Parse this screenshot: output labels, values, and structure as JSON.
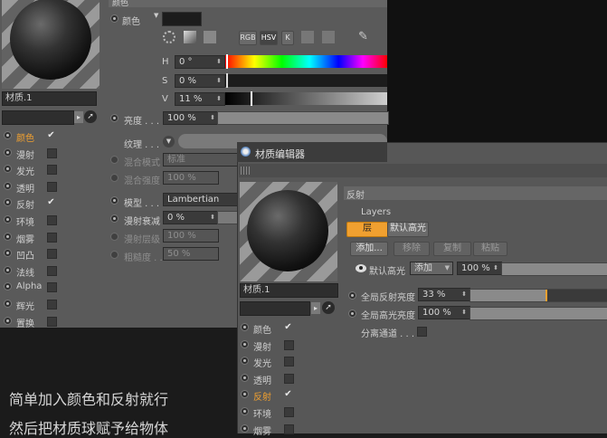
{
  "back_panel": {
    "section_title": "颜色",
    "color_label": "颜色",
    "mode_tabs": [
      "RGB",
      "HSV",
      "K"
    ],
    "h_label": "H",
    "h_value": "0 °",
    "s_label": "S",
    "s_value": "0 %",
    "v_label": "V",
    "v_value": "11 %",
    "brightness_label": "亮度 . . .",
    "brightness_value": "100 %",
    "texture_label": "纹理 . . .",
    "mix_mode_label": "混合模式",
    "mix_mode_value": "标准",
    "mix_strength_label": "混合强度",
    "mix_strength_value": "100 %",
    "model_label": "模型 . . .",
    "model_value": "Lambertian",
    "diffuse_falloff_label": "漫射衰减",
    "diffuse_falloff_value": "0 %",
    "diffuse_level_label": "漫射层级",
    "diffuse_level_value": "100 %",
    "roughness_label": "粗糙度 . .",
    "roughness_value": "50 %"
  },
  "left_material": {
    "name": "材质.1",
    "channels": [
      {
        "label": "颜色",
        "checked": true,
        "active": true
      },
      {
        "label": "漫射",
        "checked": false,
        "active": false
      },
      {
        "label": "发光",
        "checked": false,
        "active": false
      },
      {
        "label": "透明",
        "checked": false,
        "active": false
      },
      {
        "label": "反射",
        "checked": true,
        "active": false
      },
      {
        "label": "环境",
        "checked": false,
        "active": false
      },
      {
        "label": "烟雾",
        "checked": false,
        "active": false
      },
      {
        "label": "凹凸",
        "checked": false,
        "active": false
      },
      {
        "label": "法线",
        "checked": false,
        "active": false
      },
      {
        "label": "Alpha",
        "checked": false,
        "active": false
      },
      {
        "label": "辉光",
        "checked": false,
        "active": false
      },
      {
        "label": "置换",
        "checked": false,
        "active": false
      }
    ]
  },
  "editor": {
    "title": "材质编辑器",
    "name": "材质.1",
    "section_title": "反射",
    "layers_label": "Layers",
    "layer_tab": "层",
    "default_highlight_tab": "默认高光",
    "add_button": "添加...",
    "remove_button": "移除",
    "copy_button": "复制",
    "paste_button": "粘贴",
    "highlight_row_label": "默认高光",
    "blend_value": "添加",
    "highlight_value": "100 %",
    "global_reflect_label": "全局反射亮度",
    "global_reflect_value": "33 %",
    "global_reflect_level": 0.33,
    "global_highlight_label": "全局高光亮度",
    "global_highlight_value": "100 %",
    "separate_pass_label": "分离通道 . . . .",
    "channels": [
      {
        "label": "颜色",
        "checked": true,
        "active": false
      },
      {
        "label": "漫射",
        "checked": false,
        "active": false
      },
      {
        "label": "发光",
        "checked": false,
        "active": false
      },
      {
        "label": "透明",
        "checked": false,
        "active": false
      },
      {
        "label": "反射",
        "checked": true,
        "active": true
      },
      {
        "label": "环境",
        "checked": false,
        "active": false
      },
      {
        "label": "烟雾",
        "checked": false,
        "active": false
      }
    ]
  },
  "caption": {
    "line1": "简单加入颜色和反射就行",
    "line2": "然后把材质球赋予给物体"
  },
  "colors": {
    "accent": "#f0a030",
    "panel": "#5a5a5a",
    "background": "#1b1b1b"
  }
}
